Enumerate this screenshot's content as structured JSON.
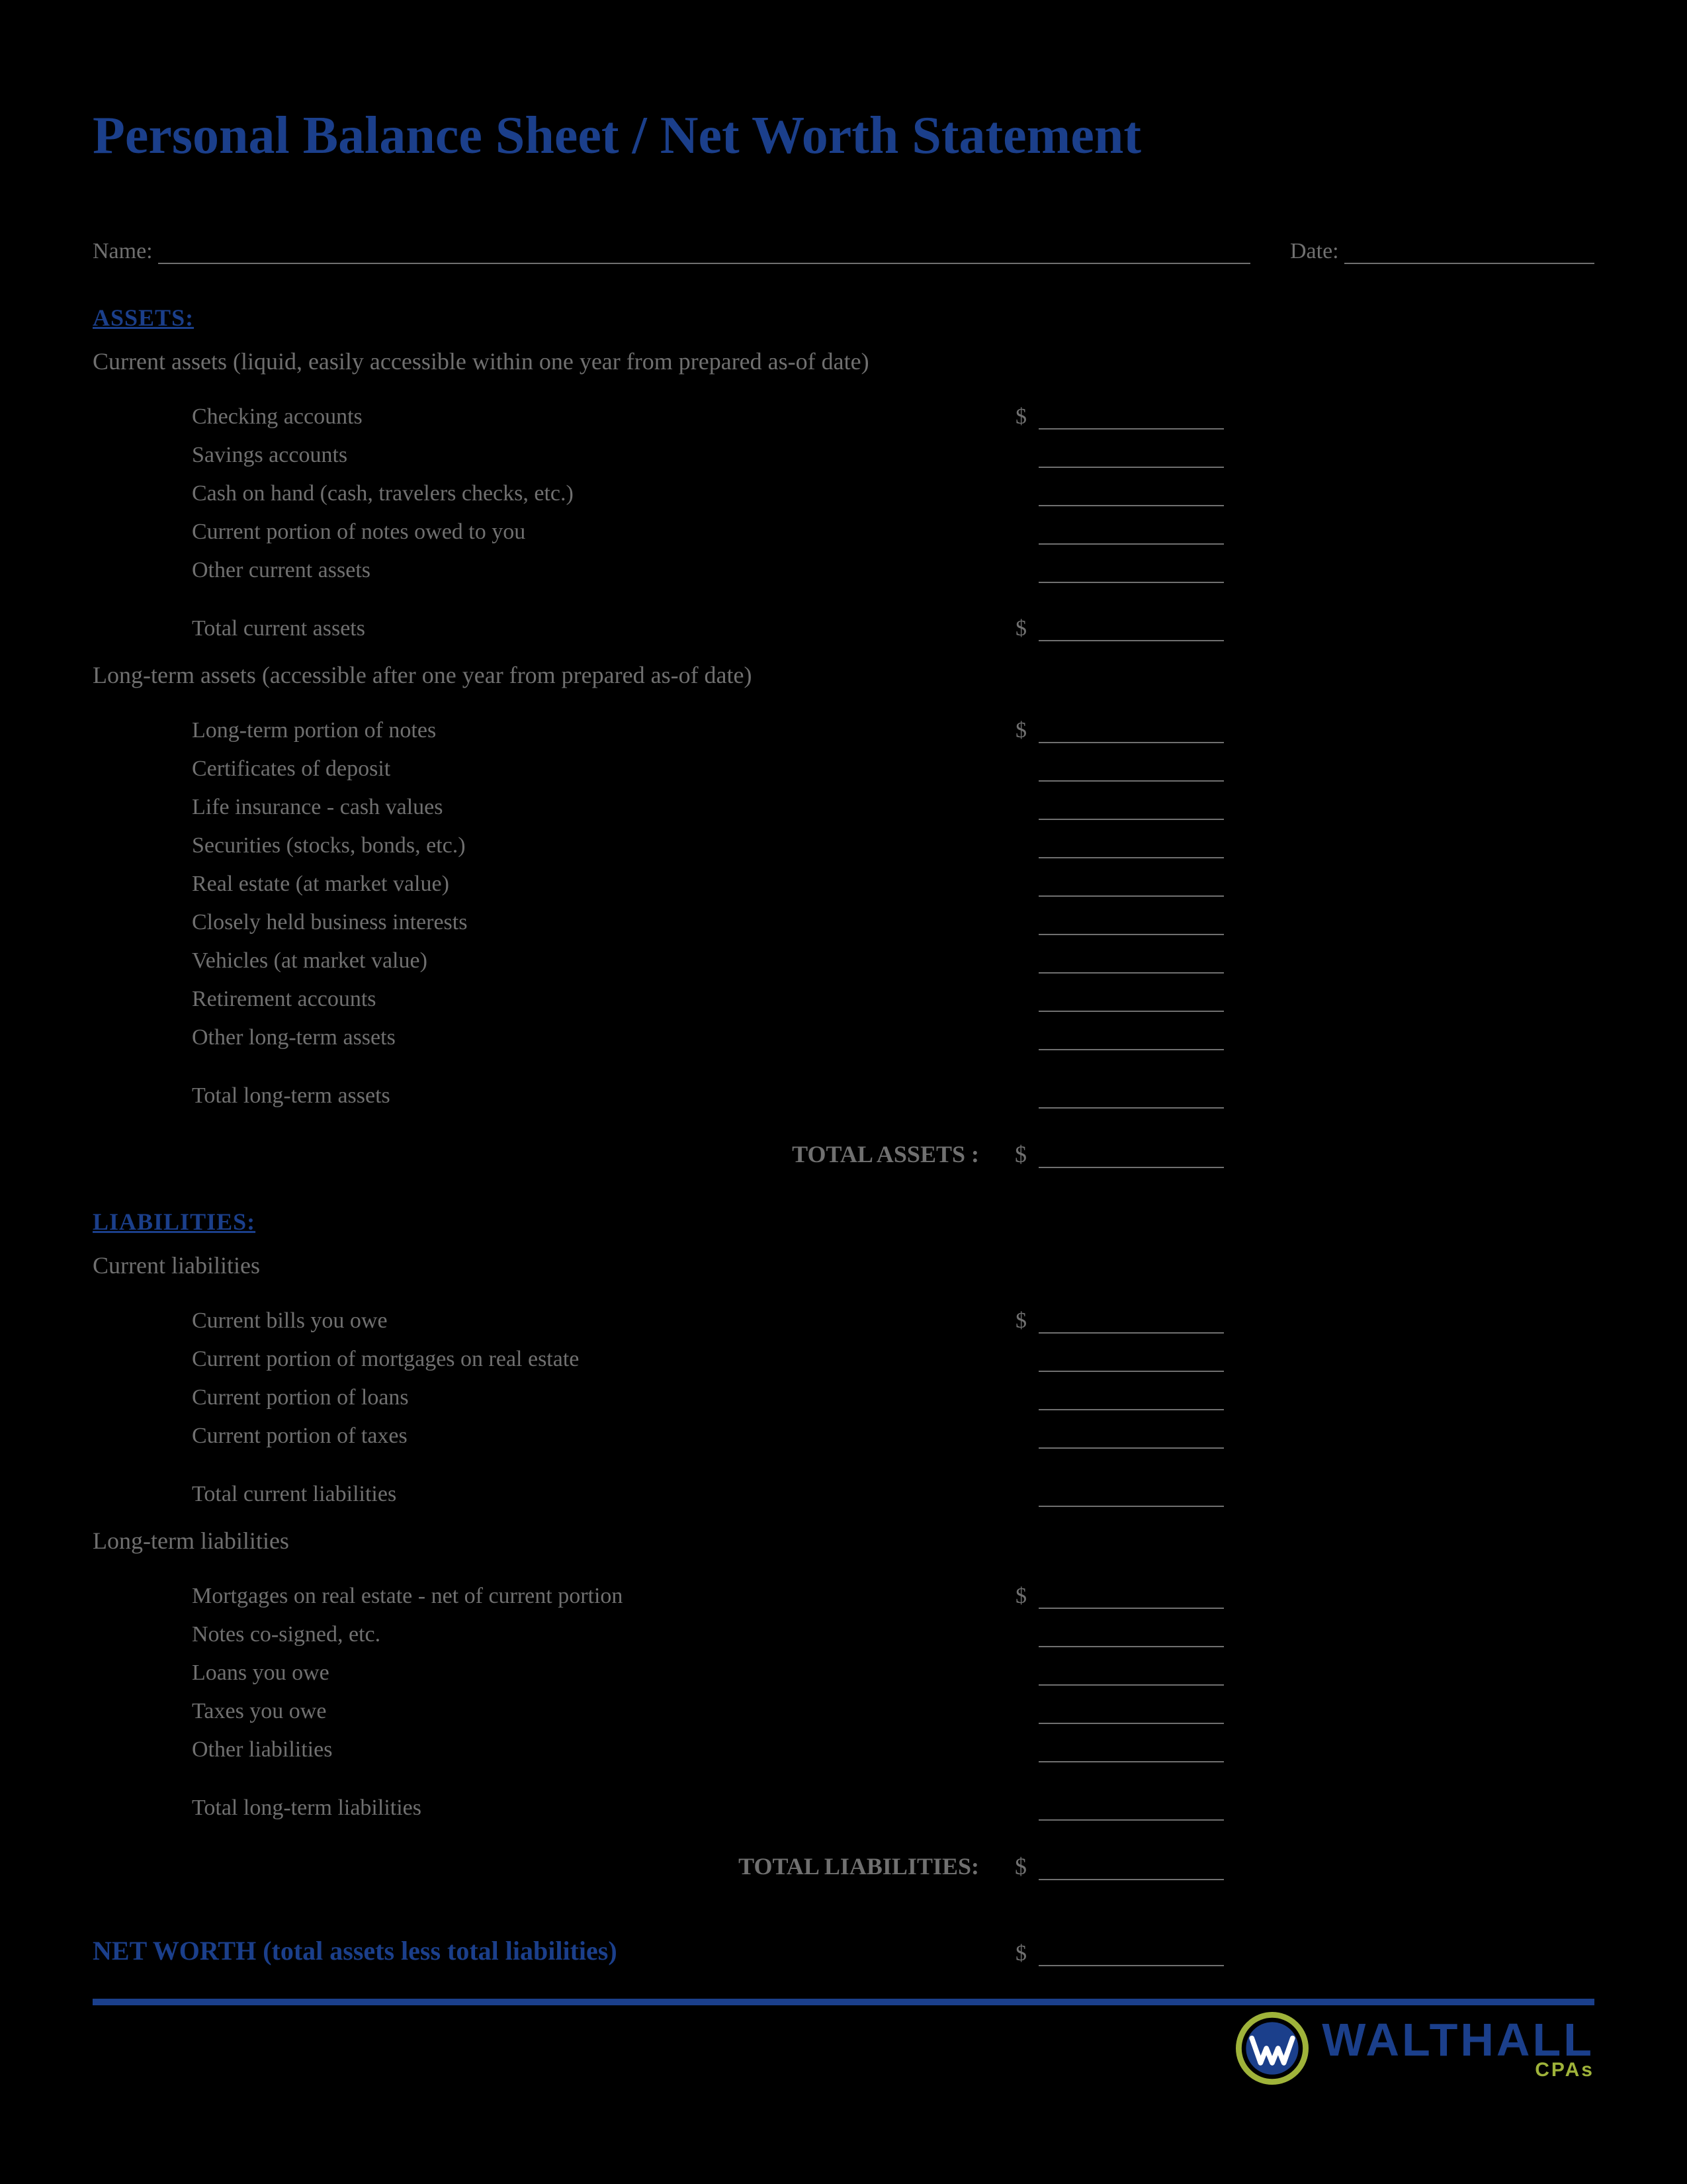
{
  "title": "Personal Balance Sheet / Net Worth Statement",
  "header": {
    "nameLabel": "Name:",
    "dateLabel": "Date:"
  },
  "assets": {
    "heading": "ASSETS:",
    "current": {
      "heading": "Current assets (liquid, easily accessible within one year from prepared as-of date)",
      "items": [
        {
          "label": "Checking accounts",
          "dollar": "$"
        },
        {
          "label": "Savings accounts",
          "dollar": ""
        },
        {
          "label": "Cash on hand (cash, travelers checks, etc.)",
          "dollar": ""
        },
        {
          "label": "Current portion of notes owed to you",
          "dollar": ""
        },
        {
          "label": "Other current assets",
          "dollar": ""
        }
      ],
      "total": {
        "label": "Total current assets",
        "dollar": "$"
      }
    },
    "longterm": {
      "heading": "Long-term assets (accessible after one year from prepared as-of date)",
      "items": [
        {
          "label": "Long-term portion of notes",
          "dollar": "$"
        },
        {
          "label": "Certificates of deposit",
          "dollar": ""
        },
        {
          "label": "Life insurance - cash values",
          "dollar": ""
        },
        {
          "label": "Securities (stocks, bonds, etc.)",
          "dollar": ""
        },
        {
          "label": "Real estate (at market value)",
          "dollar": ""
        },
        {
          "label": "Closely held business interests",
          "dollar": ""
        },
        {
          "label": "Vehicles (at market value)",
          "dollar": ""
        },
        {
          "label": "Retirement accounts",
          "dollar": ""
        },
        {
          "label": "Other long-term assets",
          "dollar": ""
        }
      ],
      "total": {
        "label": "Total long-term assets",
        "dollar": ""
      }
    },
    "grand": {
      "label": "TOTAL ASSETS :",
      "dollar": "$"
    }
  },
  "liabilities": {
    "heading": "LIABILITIES:",
    "current": {
      "heading": "Current liabilities",
      "items": [
        {
          "label": "Current bills you owe",
          "dollar": "$"
        },
        {
          "label": "Current portion of mortgages on real estate",
          "dollar": ""
        },
        {
          "label": "Current portion of loans",
          "dollar": ""
        },
        {
          "label": "Current portion of taxes",
          "dollar": ""
        }
      ],
      "total": {
        "label": "Total current liabilities",
        "dollar": ""
      }
    },
    "longterm": {
      "heading": "Long-term liabilities",
      "items": [
        {
          "label": "Mortgages on real estate - net of current portion",
          "dollar": "$"
        },
        {
          "label": "Notes co-signed, etc.",
          "dollar": ""
        },
        {
          "label": "Loans you owe",
          "dollar": ""
        },
        {
          "label": "Taxes you owe",
          "dollar": ""
        },
        {
          "label": "Other liabilities",
          "dollar": ""
        }
      ],
      "total": {
        "label": "Total long-term liabilities",
        "dollar": ""
      }
    },
    "grand": {
      "label": "TOTAL LIABILITIES:",
      "dollar": "$"
    }
  },
  "networth": {
    "label": "NET WORTH (total assets less total liabilities)",
    "dollar": "$"
  },
  "brand": {
    "name": "WALTHALL",
    "sub": "CPAs"
  }
}
